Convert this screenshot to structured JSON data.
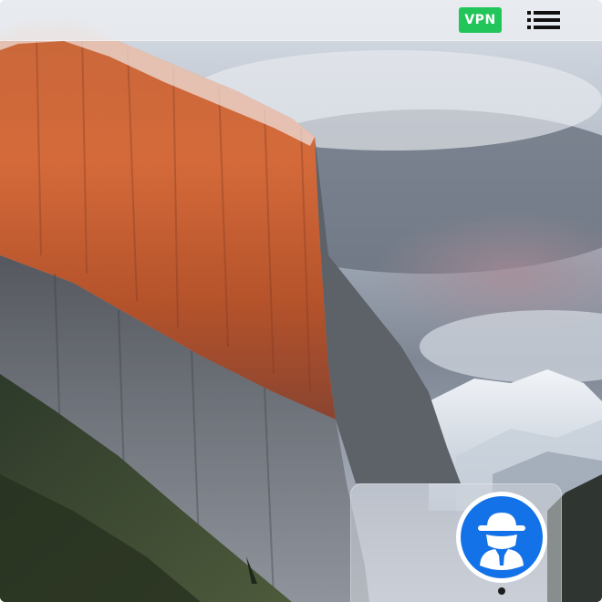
{
  "menubar": {
    "vpn_label": "VPN",
    "vpn_color": "#21c55a",
    "menu_icon": "list-icon"
  },
  "dock": {
    "app_icon": "incognito-spy-icon",
    "app_color": "#1472e8",
    "running": true
  },
  "wallpaper": {
    "subject": "mountain-cliff-landscape"
  }
}
